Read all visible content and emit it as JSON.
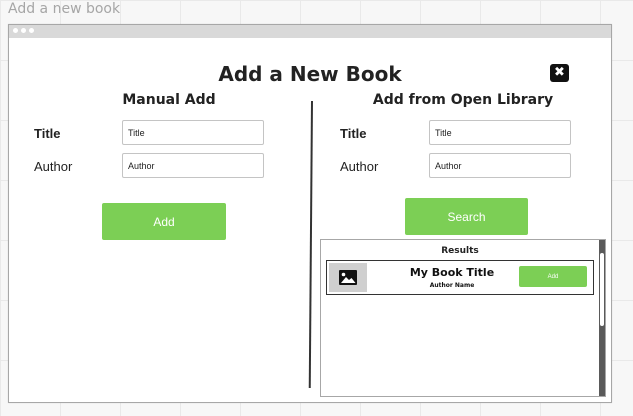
{
  "canvas": {
    "label": "Add a new book"
  },
  "dialog": {
    "title": "Add a New Book",
    "close_label": "✖"
  },
  "manual": {
    "heading": "Manual Add",
    "title_label": "Title",
    "title_placeholder": "Title",
    "author_label": "Author",
    "author_placeholder": "Author",
    "add_label": "Add"
  },
  "open_library": {
    "heading": "Add from Open Library",
    "title_label": "Title",
    "title_placeholder": "Title",
    "author_label": "Author",
    "author_placeholder": "Author",
    "search_label": "Search",
    "results": {
      "heading": "Results",
      "items": [
        {
          "title": "My Book Title",
          "author": "Author Name",
          "add_label": "Add"
        }
      ]
    }
  },
  "colors": {
    "accent_green": "#7ccf55",
    "dark": "#111111"
  }
}
